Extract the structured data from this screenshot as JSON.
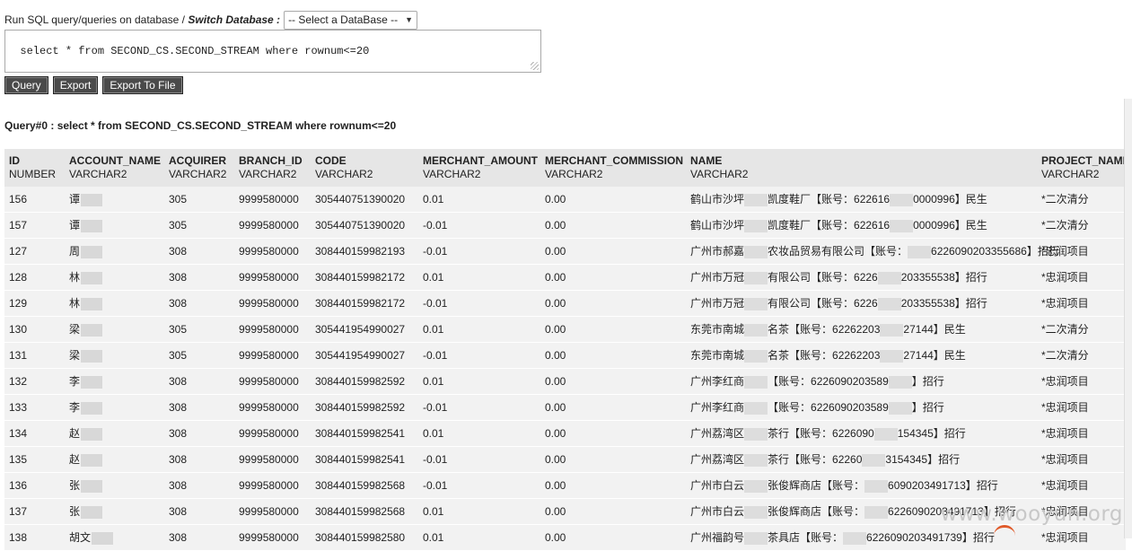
{
  "toolbar": {
    "prompt_label": "Run SQL query/queries on database / ",
    "switch_label": "Switch Database :",
    "db_select_value": "-- Select a DataBase --",
    "sql_text": "select * from SECOND_CS.SECOND_STREAM where rownum<=20",
    "buttons": {
      "query": "Query",
      "export": "Export",
      "export_file": "Export To File"
    }
  },
  "query_title": "Query#0 : select * from SECOND_CS.SECOND_STREAM where rownum<=20",
  "columns": [
    {
      "name": "ID",
      "type": "NUMBER"
    },
    {
      "name": "ACCOUNT_NAME",
      "type": "VARCHAR2"
    },
    {
      "name": "ACQUIRER",
      "type": "VARCHAR2"
    },
    {
      "name": "BRANCH_ID",
      "type": "VARCHAR2"
    },
    {
      "name": "CODE",
      "type": "VARCHAR2"
    },
    {
      "name": "MERCHANT_AMOUNT",
      "type": "VARCHAR2"
    },
    {
      "name": "MERCHANT_COMMISSION",
      "type": "VARCHAR2"
    },
    {
      "name": "NAME",
      "type": "VARCHAR2"
    },
    {
      "name": "PROJECT_NAME",
      "type": "VARCHAR2"
    }
  ],
  "rows": [
    {
      "id": "156",
      "acct": "谭",
      "acq": "305",
      "branch": "9999580000",
      "code": "305440751390020",
      "amount": "0.01",
      "comm": "0.00",
      "name_a": "鹤山市沙坪",
      "name_b": "凯度鞋厂【账号：622616",
      "name_c": "0000996】民生",
      "project": "*二次清分"
    },
    {
      "id": "157",
      "acct": "谭",
      "acq": "305",
      "branch": "9999580000",
      "code": "305440751390020",
      "amount": "-0.01",
      "comm": "0.00",
      "name_a": "鹤山市沙坪",
      "name_b": "凯度鞋厂【账号：622616",
      "name_c": "0000996】民生",
      "project": "*二次清分"
    },
    {
      "id": "127",
      "acct": "周",
      "acq": "308",
      "branch": "9999580000",
      "code": "308440159982193",
      "amount": "-0.01",
      "comm": "0.00",
      "name_a": "广州市郝嘉",
      "name_b": "农妆品贸易有限公司【账号：",
      "name_c": "6226090203355686】招行",
      "project": "*忠润项目"
    },
    {
      "id": "128",
      "acct": "林",
      "acq": "308",
      "branch": "9999580000",
      "code": "308440159982172",
      "amount": "0.01",
      "comm": "0.00",
      "name_a": "广州市万冠",
      "name_b": "有限公司【账号：6226",
      "name_c": "203355538】招行",
      "project": "*忠润项目"
    },
    {
      "id": "129",
      "acct": "林",
      "acq": "308",
      "branch": "9999580000",
      "code": "308440159982172",
      "amount": "-0.01",
      "comm": "0.00",
      "name_a": "广州市万冠",
      "name_b": "有限公司【账号：6226",
      "name_c": "203355538】招行",
      "project": "*忠润项目"
    },
    {
      "id": "130",
      "acct": "梁",
      "acq": "305",
      "branch": "9999580000",
      "code": "305441954990027",
      "amount": "0.01",
      "comm": "0.00",
      "name_a": "东莞市南城",
      "name_b": "名茶【账号：62262203",
      "name_c": "27144】民生",
      "project": "*二次清分"
    },
    {
      "id": "131",
      "acct": "梁",
      "acq": "305",
      "branch": "9999580000",
      "code": "305441954990027",
      "amount": "-0.01",
      "comm": "0.00",
      "name_a": "东莞市南城",
      "name_b": "名茶【账号：62262203",
      "name_c": "27144】民生",
      "project": "*二次清分"
    },
    {
      "id": "132",
      "acct": "李",
      "acq": "308",
      "branch": "9999580000",
      "code": "308440159982592",
      "amount": "0.01",
      "comm": "0.00",
      "name_a": "广州李红商",
      "name_b": "【账号：6226090203589",
      "name_c": "】招行",
      "project": "*忠润项目"
    },
    {
      "id": "133",
      "acct": "李",
      "acq": "308",
      "branch": "9999580000",
      "code": "308440159982592",
      "amount": "-0.01",
      "comm": "0.00",
      "name_a": "广州李红商",
      "name_b": "【账号：6226090203589",
      "name_c": "】招行",
      "project": "*忠润项目"
    },
    {
      "id": "134",
      "acct": "赵",
      "acq": "308",
      "branch": "9999580000",
      "code": "308440159982541",
      "amount": "0.01",
      "comm": "0.00",
      "name_a": "广州荔湾区",
      "name_b": "茶行【账号：6226090",
      "name_c": "154345】招行",
      "project": "*忠润项目"
    },
    {
      "id": "135",
      "acct": "赵",
      "acq": "308",
      "branch": "9999580000",
      "code": "308440159982541",
      "amount": "-0.01",
      "comm": "0.00",
      "name_a": "广州荔湾区",
      "name_b": "茶行【账号：62260",
      "name_c": "3154345】招行",
      "project": "*忠润项目"
    },
    {
      "id": "136",
      "acct": "张",
      "acq": "308",
      "branch": "9999580000",
      "code": "308440159982568",
      "amount": "-0.01",
      "comm": "0.00",
      "name_a": "广州市白云",
      "name_b": "张俊辉商店【账号：",
      "name_c": "6090203491713】招行",
      "project": "*忠润项目"
    },
    {
      "id": "137",
      "acct": "张",
      "acq": "308",
      "branch": "9999580000",
      "code": "308440159982568",
      "amount": "0.01",
      "comm": "0.00",
      "name_a": "广州市白云",
      "name_b": "张俊辉商店【账号：",
      "name_c": "6226090203491713】招行",
      "project": "*忠润项目"
    },
    {
      "id": "138",
      "acct": "胡文",
      "acq": "308",
      "branch": "9999580000",
      "code": "308440159982580",
      "amount": "0.01",
      "comm": "0.00",
      "name_a": "广州福韵号",
      "name_b": "茶具店【账号：",
      "name_c": "6226090203491739】招行",
      "project": "*忠润项目"
    }
  ],
  "watermark": "www.wooyun.org"
}
